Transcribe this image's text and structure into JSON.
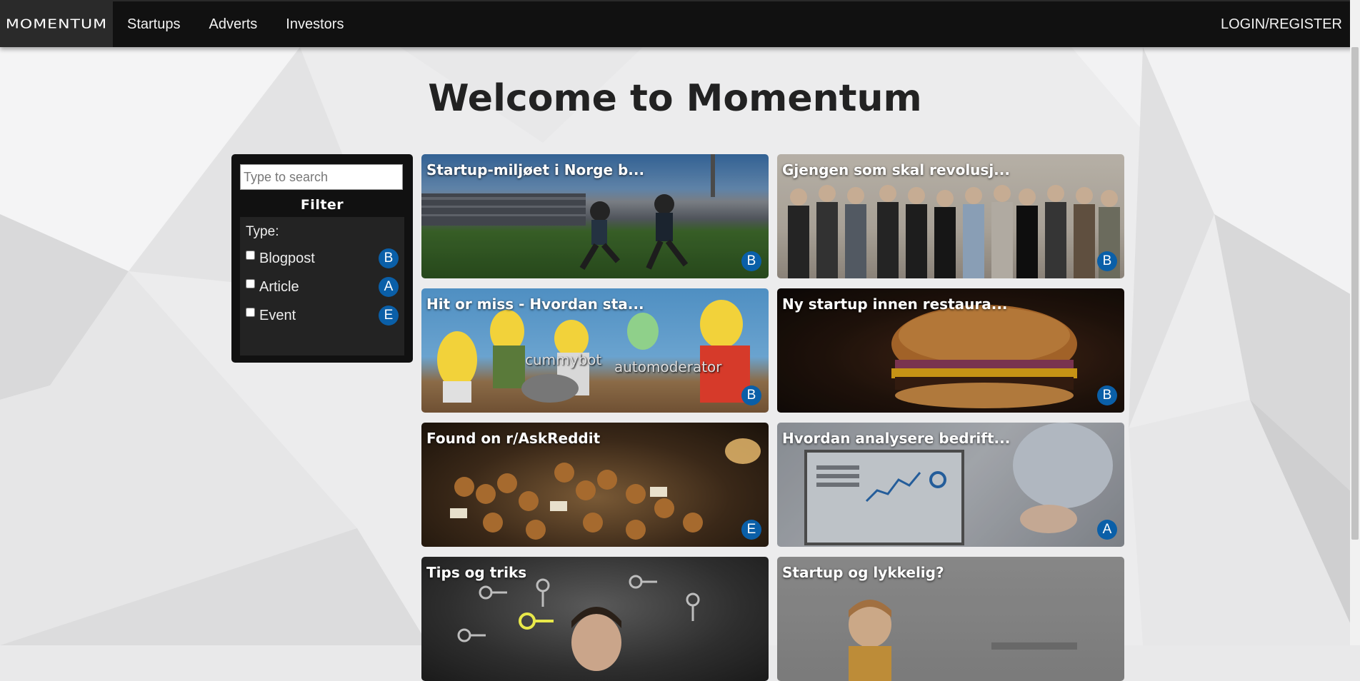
{
  "nav": {
    "brand": "MOMENTUM",
    "links": [
      "Startups",
      "Adverts",
      "Investors"
    ],
    "login": "LOGIN/REGISTER"
  },
  "page": {
    "title": "Welcome to Momentum"
  },
  "filter": {
    "search_placeholder": "Type to search",
    "title": "Filter",
    "type_label": "Type:",
    "options": [
      {
        "label": "Blogpost",
        "badge": "B",
        "checked": false
      },
      {
        "label": "Article",
        "badge": "A",
        "checked": false
      },
      {
        "label": "Event",
        "badge": "E",
        "checked": false
      }
    ]
  },
  "cards": [
    {
      "title": "Startup-miljøet i Norge b...",
      "badge": "B",
      "image": "stadium-runners"
    },
    {
      "title": "Gjengen som skal revolusj...",
      "badge": "B",
      "image": "group-photo"
    },
    {
      "title": "Hit or miss - Hvordan sta...",
      "badge": "B",
      "image": "cartoon-meme",
      "overlay": [
        "cummybot",
        "automoderator"
      ]
    },
    {
      "title": "Ny startup innen restaura...",
      "badge": "B",
      "image": "burger"
    },
    {
      "title": "Found on r/AskReddit",
      "badge": "E",
      "image": "pastries"
    },
    {
      "title": "Hvordan analysere bedrift...",
      "badge": "A",
      "image": "analytics-screen"
    },
    {
      "title": "Tips og triks",
      "badge": "",
      "image": "keys-thinking"
    },
    {
      "title": "Startup og lykkelig?",
      "badge": "",
      "image": "child"
    }
  ],
  "colors": {
    "badge": "#0a5fa8",
    "navbar": "#111111",
    "brand_bg": "#2a2a2a"
  }
}
